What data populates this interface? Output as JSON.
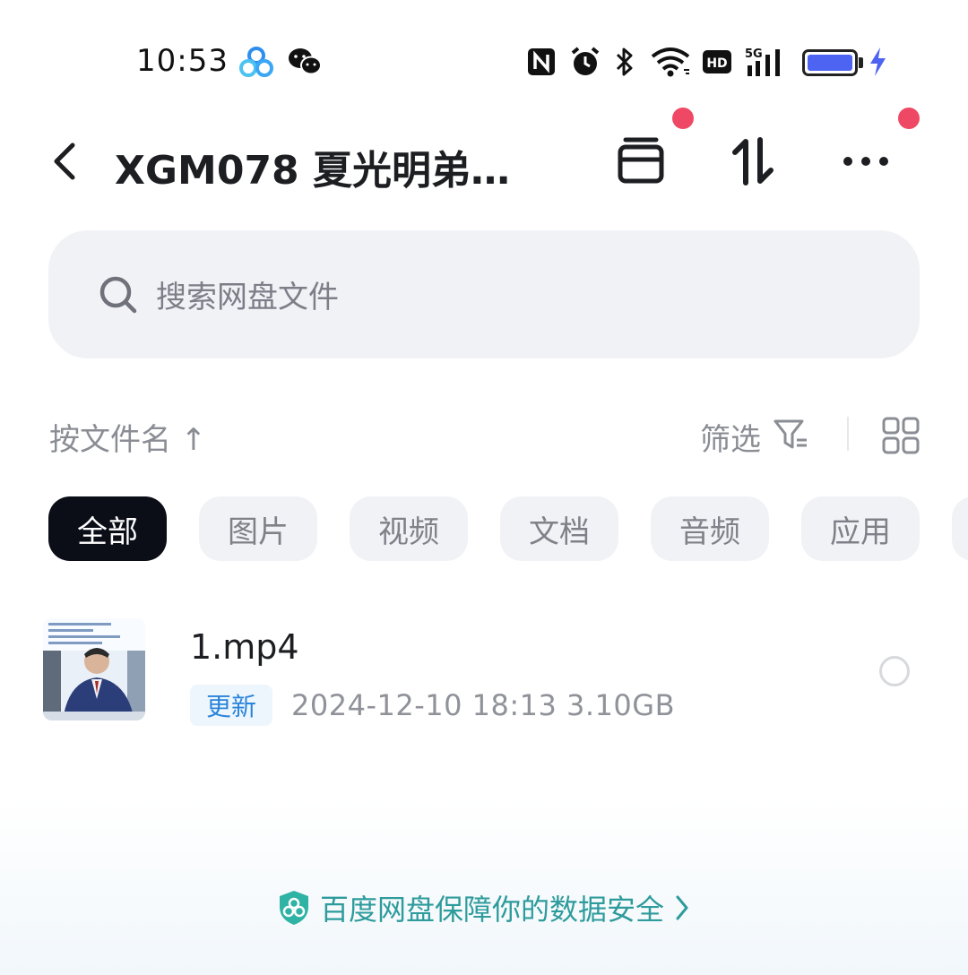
{
  "status_bar": {
    "time": "10:53",
    "network": "5G",
    "hd_label": "HD",
    "battery_color": "#4d63f2"
  },
  "header": {
    "title": "XGM078 夏光明弟…",
    "back_icon": "chevron-left-icon",
    "archive_icon": "archive-box-icon",
    "transfer_icon": "transfer-arrows-icon",
    "more_icon": "more-dots-icon",
    "notification_dot_color": "#ef4864"
  },
  "search": {
    "placeholder": "搜索网盘文件"
  },
  "sort_bar": {
    "sort_label": "按文件名 ↑",
    "filter_label": "筛选"
  },
  "categories": [
    {
      "label": "全部",
      "active": true
    },
    {
      "label": "图片",
      "active": false
    },
    {
      "label": "视频",
      "active": false
    },
    {
      "label": "文档",
      "active": false
    },
    {
      "label": "音频",
      "active": false
    },
    {
      "label": "应用",
      "active": false
    }
  ],
  "files": [
    {
      "name": "1.mp4",
      "badge": "更新",
      "meta": "2024-12-10  18:13  3.10GB"
    }
  ],
  "footer": {
    "text": "百度网盘保障你的数据安全",
    "accent_color": "#2e9b9c"
  }
}
